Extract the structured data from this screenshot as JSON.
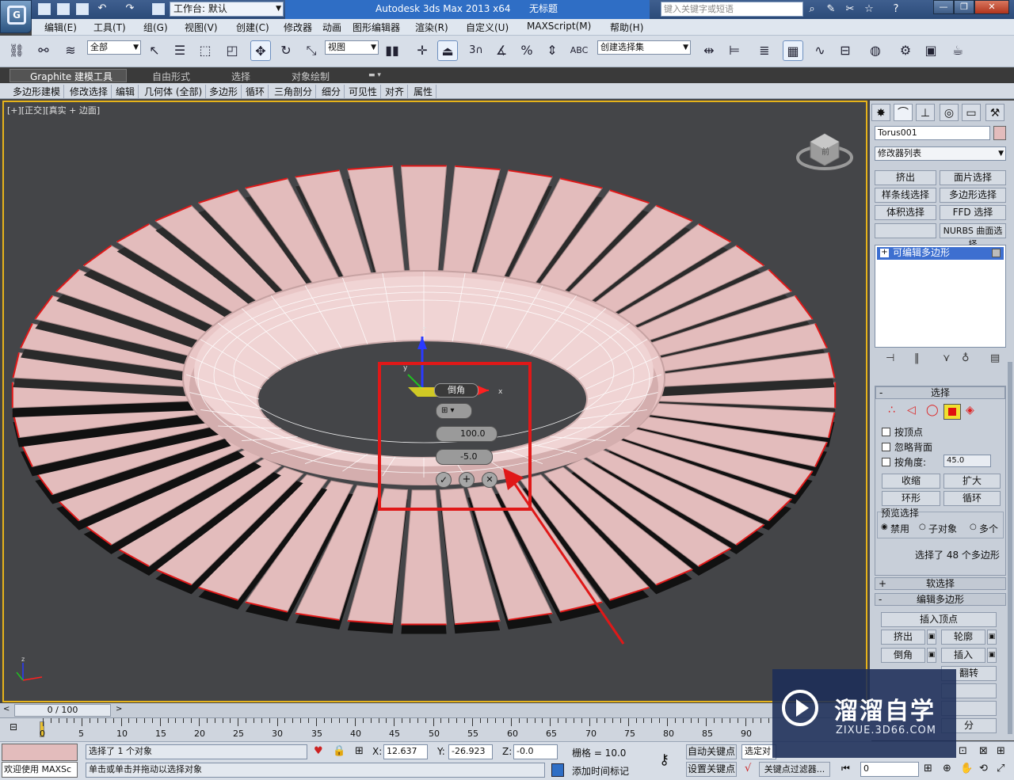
{
  "titlebar": {
    "workspace_label": "工作台: 默认",
    "app_title": "Autodesk 3ds Max  2013 x64",
    "doc_title": "无标题",
    "search_placeholder": "键入关键字或短语"
  },
  "menubar": [
    "编辑(E)",
    "工具(T)",
    "组(G)",
    "视图(V)",
    "创建(C)",
    "修改器",
    "动画",
    "图形编辑器",
    "渲染(R)",
    "自定义(U)",
    "MAXScript(M)",
    "帮助(H)"
  ],
  "toolbar": {
    "filter_value": "全部",
    "ref_coord_value": "视图",
    "snap_label": "3",
    "selection_set_placeholder": "创建选择集"
  },
  "ribbon": {
    "tabs": [
      "Graphite 建模工具",
      "自由形式",
      "选择",
      "对象绘制"
    ],
    "panels": [
      "多边形建模",
      "修改选择",
      "编辑",
      "几何体 (全部)",
      "多边形",
      "循环",
      "三角剖分",
      "细分",
      "可见性",
      "对齐",
      "属性"
    ]
  },
  "viewport": {
    "label": "[+][正交][真实 + 边面]",
    "bevel_caddy": {
      "title": "倒角",
      "height_value": "100.0",
      "outline_value": "-5.0"
    },
    "gizmo_z": "z",
    "gizmo_x": "x",
    "gizmo_y": "y",
    "viewcube_label": "前"
  },
  "command_panel": {
    "object_name": "Torus001",
    "modifier_list_label": "修改器列表",
    "modifier_buttons": [
      "挤出",
      "面片选择",
      "样条线选择",
      "多边形选择",
      "体积选择",
      "FFD 选择",
      "",
      "NURBS 曲面选择"
    ],
    "stack_item": "可编辑多边形",
    "selection": {
      "header": "选择",
      "by_vertex": "按顶点",
      "ignore_backfacing": "忽略背面",
      "by_angle": "按角度:",
      "angle_value": "45.0",
      "shrink": "收缩",
      "grow": "扩大",
      "ring": "环形",
      "loop": "循环",
      "preview_label": "预览选择",
      "preview_off": "禁用",
      "preview_subobj": "子对象",
      "preview_multi": "多个",
      "status": "选择了 48 个多边形"
    },
    "soft_selection": "软选择",
    "edit_polygons": {
      "header": "编辑多边形",
      "insert_vertex": "插入顶点",
      "extrude": "挤出",
      "outline": "轮廓",
      "bevel": "倒角",
      "inset": "插入",
      "flip": "翻转",
      "extra": "分"
    }
  },
  "timeline": {
    "frame_counter": "0 / 100",
    "ticks": [
      "0",
      "5",
      "10",
      "15",
      "20",
      "25",
      "30",
      "35",
      "40",
      "45",
      "50",
      "55",
      "60",
      "65",
      "70",
      "75",
      "80",
      "85",
      "90"
    ]
  },
  "statusbar": {
    "maxscript_label": "欢迎使用 MAXSc",
    "selected_text": "选择了 1 个对象",
    "prompt_text": "单击或单击并拖动以选择对象",
    "x_label": "X:",
    "x_value": "12.637",
    "y_label": "Y:",
    "y_value": "-26.923",
    "z_label": "Z:",
    "z_value": "-0.0",
    "grid_text": "栅格 = 10.0",
    "add_time_tag": "添加时间标记",
    "auto_key": "自动关键点",
    "set_key": "设置关键点",
    "selected_obj": "选定对",
    "key_filters": "关键点过滤器...",
    "frame_value": "0"
  },
  "watermark": {
    "brand": "溜溜自学",
    "url": "ZIXUE.3D66.COM"
  },
  "colors": {
    "object": "#e3bcbc",
    "highlight": "#e6b31a",
    "annotation": "#e01818"
  }
}
